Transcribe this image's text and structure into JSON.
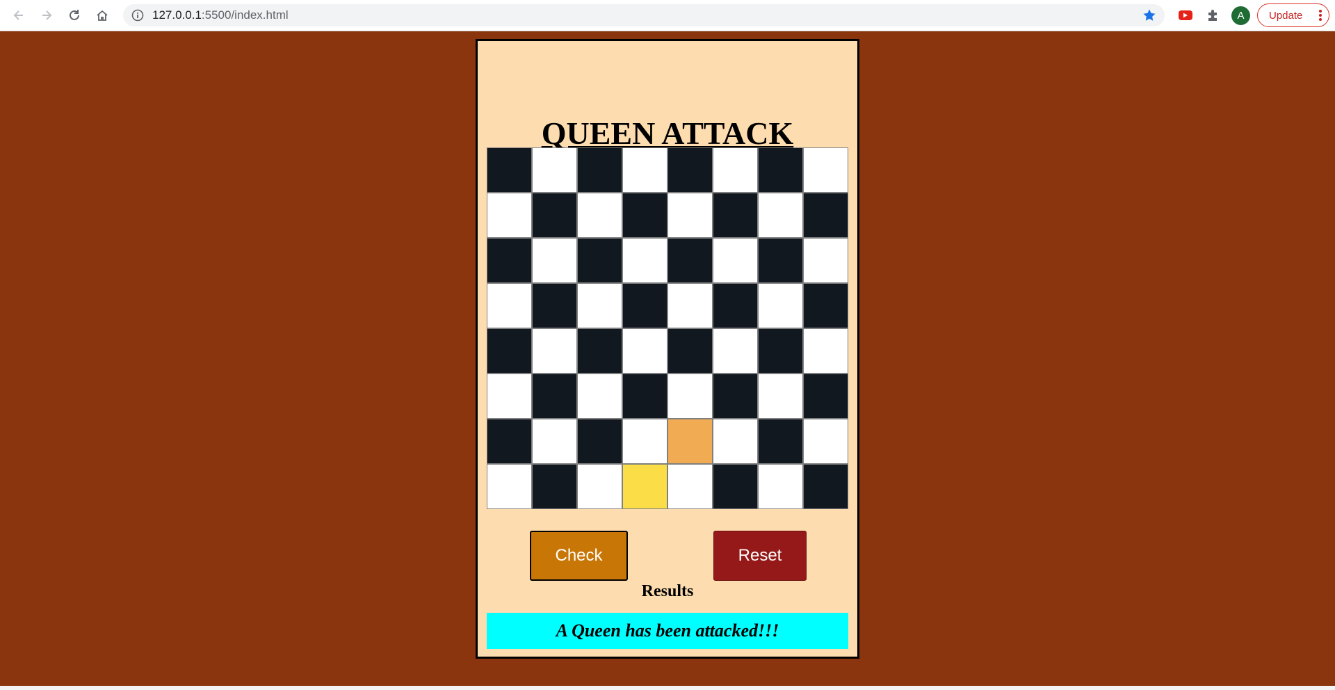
{
  "browser": {
    "url_host": "127.0.0.1",
    "url_path": ":5500/index.html",
    "update_label": "Update",
    "avatar_letter": "A",
    "icons": {
      "back": "arrow-left-icon",
      "forward": "arrow-right-icon",
      "reload": "reload-icon",
      "home": "home-icon",
      "info": "info-icon",
      "bookmark": "star-icon",
      "youtube_ext": "youtube-extension-icon",
      "extensions": "puzzle-icon",
      "menu": "kebab-menu-icon"
    }
  },
  "app": {
    "title": "QUEEN ATTACK",
    "check_label": "Check",
    "reset_label": "Reset",
    "results_label": "Results",
    "result_message": "A Queen has been attacked!!!",
    "colors": {
      "page_bg": "#8b350f",
      "card_bg": "#fddcaf",
      "dark_square": "#111820",
      "light_square": "#ffffff",
      "queen_1": "#f1ab52",
      "queen_2": "#fbdd48",
      "check_button": "#c87605",
      "reset_button": "#951919",
      "result_bg": "#00ffff"
    },
    "board": {
      "size": 8,
      "highlighted": [
        {
          "row": 6,
          "col": 4,
          "color": "#f1ab52"
        },
        {
          "row": 7,
          "col": 3,
          "color": "#fbdd48"
        }
      ]
    }
  }
}
